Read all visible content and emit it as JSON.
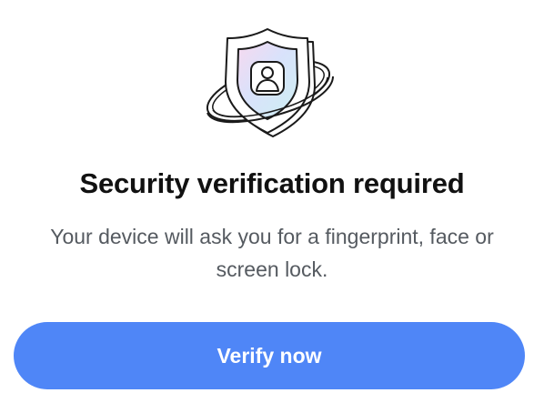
{
  "dialog": {
    "illustration_icon": "shield-user-orbit-icon",
    "title": "Security verification required",
    "message": "Your device will ask you for a fingerprint, face or screen lock.",
    "primary_button_label": "Verify now"
  },
  "colors": {
    "primary": "#4f86f7",
    "title_text": "#111111",
    "message_text": "#555a60",
    "background": "#ffffff"
  }
}
